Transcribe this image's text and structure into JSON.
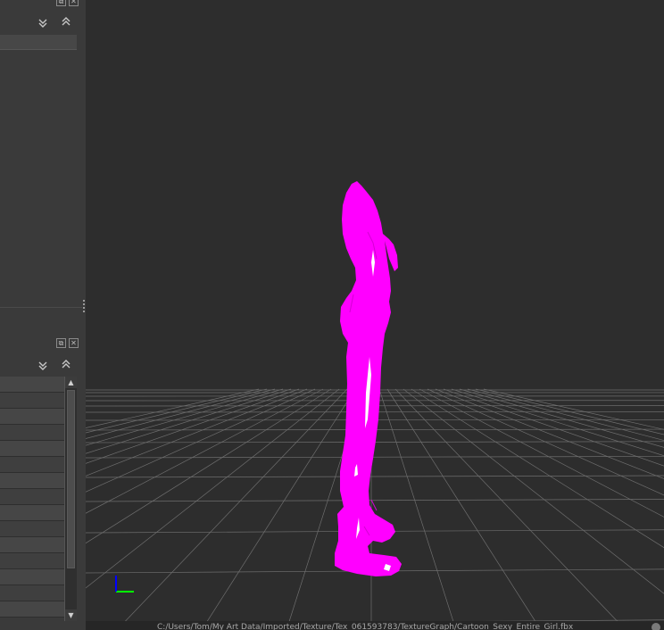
{
  "colors": {
    "background": "#2d2d2d",
    "grid": "#6e6e6e",
    "model": "#ff00ff",
    "axis_x": "#00ff00",
    "axis_y": "#0000ff",
    "dock": "#3a3a3a"
  },
  "icons": {
    "float": "float-window-icon",
    "close": "close-window-icon",
    "collapse": "double-chevron-down-icon",
    "expand": "double-chevron-up-icon",
    "scroll_up": "arrow-up-icon",
    "scroll_down": "arrow-down-icon"
  },
  "glyphs": {
    "float": "⧉",
    "close": "✕",
    "collapse": "⌄",
    "expand": "⌃",
    "scroll_up": "▲",
    "scroll_down": "▼"
  },
  "status": {
    "path": "C:/Users/Tom/My Art Data/Imported/Texture/Tex_061593783/TextureGraph/Cartoon_Sexy_Entire_Girl.fbx"
  }
}
